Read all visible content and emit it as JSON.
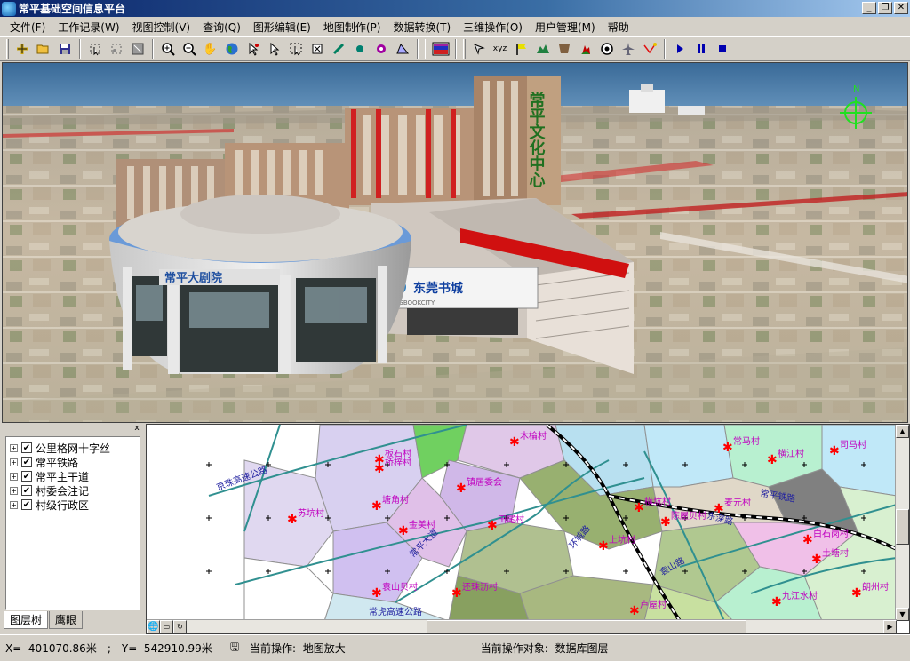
{
  "window": {
    "title": "常平基础空间信息平台",
    "controls": [
      "_",
      "❐",
      "✕"
    ]
  },
  "menu": [
    "文件(F)",
    "工作记录(W)",
    "视图控制(V)",
    "查询(Q)",
    "图形编辑(E)",
    "地图制作(P)",
    "数据转换(T)",
    "三维操作(O)",
    "用户管理(M)",
    "帮助"
  ],
  "toolbar": {
    "groups": [
      [
        "add-layer-icon",
        "open-folder-icon",
        "save-icon"
      ],
      [
        "select-tool-icon",
        "select-box-icon",
        "clear-selection-icon"
      ],
      [
        "zoom-in-icon",
        "zoom-out-icon",
        "pan-hand-icon",
        "globe-icon",
        "identify-icon",
        "select-arrow-icon",
        "select-rect-icon",
        "measure-icon",
        "edit-node-icon",
        "add-point-icon",
        "add-vertex-icon",
        "polygon-icon"
      ],
      [
        "legend-color-icon"
      ],
      [
        "fly-icon",
        "xyz-coordinate-icon",
        "flag-icon",
        "terrain-icon",
        "bookmark-icon",
        "fire-icon",
        "target-icon",
        "airplane-icon",
        "path-icon",
        "play-icon",
        "pause-icon",
        "stop-icon"
      ]
    ]
  },
  "scene": {
    "building_signs": {
      "theater": "常平大剧院",
      "bookstore": "东莞书城",
      "bookstore_en": "DGBOOKCITY",
      "culture_center": "常平文化中心"
    },
    "compass": "N"
  },
  "layers": {
    "items": [
      {
        "label": "公里格网十字丝",
        "checked": true
      },
      {
        "label": "常平铁路",
        "checked": true
      },
      {
        "label": "常平主干道",
        "checked": true
      },
      {
        "label": "村委会注记",
        "checked": true
      },
      {
        "label": "村级行政区",
        "checked": true
      }
    ],
    "tabs": [
      "图层树",
      "鹰眼"
    ],
    "close": "x"
  },
  "map": {
    "village_labels": [
      "桥梓村",
      "板石村",
      "镇居委会",
      "木棆村",
      "常马村",
      "司马村",
      "横江村",
      "苏坑村",
      "塘角村",
      "金美村",
      "田尾村",
      "麦元村",
      "横坑村",
      "上坑村",
      "土塘村",
      "袁山贝村",
      "还珠沥村",
      "卢屋村",
      "九江水村",
      "朗州村",
      "陈屋贝村",
      "白石岗村"
    ],
    "road_labels": [
      "京珠高速公路",
      "常平大道",
      "环城路",
      "东深路",
      "袁山路",
      "常虎高速公路",
      "常平铁路"
    ],
    "bottom_icons": [
      "globe-icon",
      "page-icon",
      "refresh-icon"
    ]
  },
  "status": {
    "x_label": "X=",
    "x_value": "401070.86米",
    "y_label": "Y=",
    "y_value": "542910.99米",
    "separator": ";",
    "op_label": "当前操作:",
    "op_value": "地图放大",
    "target_label": "当前操作对象:",
    "target_value": "数据库图层"
  }
}
